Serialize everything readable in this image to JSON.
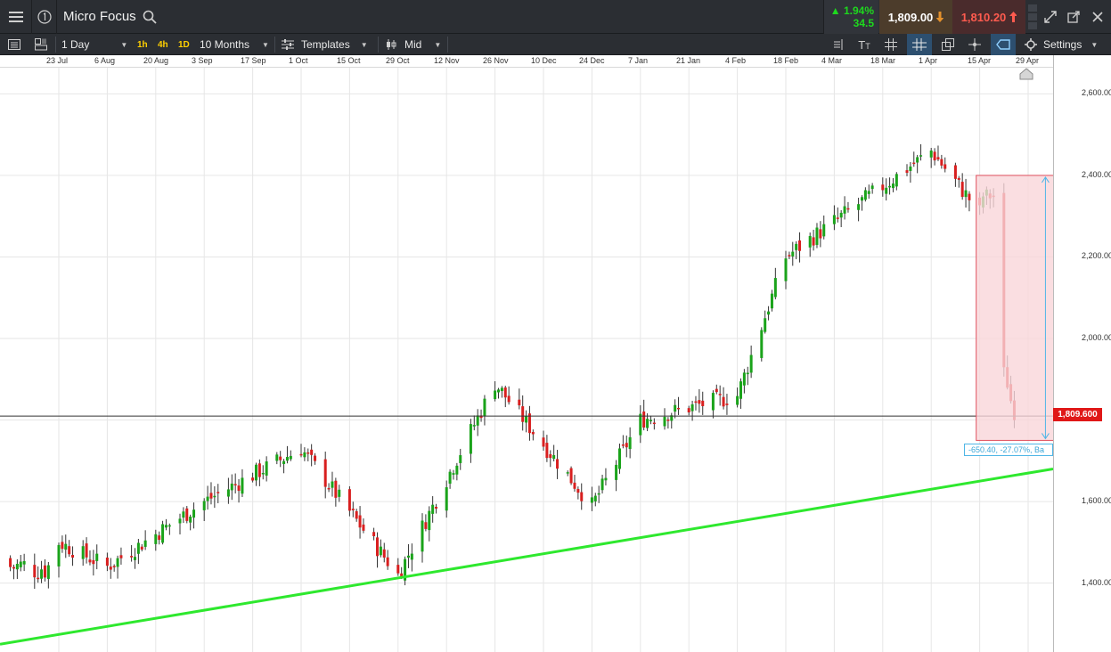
{
  "header": {
    "instrument_name": "Micro Focus",
    "change_percent": "1.94%",
    "change_abs": "34.5",
    "sell_price": "1,809.00",
    "buy_price": "1,810.20",
    "colors": {
      "up": "#1ed81e",
      "sell_bg": "#4c3c2b",
      "buy_bg": "#4a2b2c",
      "buy_text": "#ff5b4f"
    }
  },
  "toolbar": {
    "interval": "1 Day",
    "quick_intervals": [
      "1h",
      "4h",
      "1D"
    ],
    "range": "10 Months",
    "templates_label": "Templates",
    "price_mode": "Mid",
    "settings_label": "Settings"
  },
  "date_axis": [
    "23 Jul",
    "6 Aug",
    "20 Aug",
    "3 Sep",
    "17 Sep",
    "1 Oct",
    "15 Oct",
    "29 Oct",
    "12 Nov",
    "26 Nov",
    "10 Dec",
    "24 Dec",
    "7 Jan",
    "21 Jan",
    "4 Feb",
    "18 Feb",
    "4 Mar",
    "18 Mar",
    "1 Apr",
    "15 Apr",
    "29 Apr"
  ],
  "price_axis": [
    "2,600.000",
    "2,400.000",
    "2,200.000",
    "2,000.000",
    "1,600.000",
    "1,400.000"
  ],
  "last_price": "1,809.600",
  "measure_label": "-650.40, -27.07%, Ba",
  "chart_data": {
    "type": "candlestick",
    "instrument": "Micro Focus",
    "interval": "1 Day",
    "range": "10 Months",
    "x_ticks": [
      "23 Jul",
      "6 Aug",
      "20 Aug",
      "3 Sep",
      "17 Sep",
      "1 Oct",
      "15 Oct",
      "29 Oct",
      "12 Nov",
      "26 Nov",
      "10 Dec",
      "24 Dec",
      "7 Jan",
      "21 Jan",
      "4 Feb",
      "18 Feb",
      "4 Mar",
      "18 Mar",
      "1 Apr",
      "15 Apr",
      "29 Apr"
    ],
    "y_ticks": [
      1400,
      1600,
      2000,
      2200,
      2400,
      2600
    ],
    "ylim": [
      1250,
      2670
    ],
    "grid": true,
    "last_price": 1809.6,
    "colors": {
      "up": "#1aa31a",
      "down": "#d81f1f",
      "trendline": "#2ee82e",
      "measure_fill": "#f9d6da",
      "measure_stroke": "#e0505e",
      "measure_arrow": "#4fb6e6"
    },
    "key_points": [
      {
        "date": "23 Jul",
        "close": 1500
      },
      {
        "date": "6 Aug",
        "close": 1440
      },
      {
        "date": "3 Sep",
        "close": 1600
      },
      {
        "date": "1 Oct",
        "close": 1730
      },
      {
        "date": "29 Oct",
        "close": 1420
      },
      {
        "date": "26 Nov",
        "close": 1890
      },
      {
        "date": "24 Dec",
        "close": 1590
      },
      {
        "date": "7 Jan",
        "close": 1800
      },
      {
        "date": "4 Feb",
        "close": 1860
      },
      {
        "date": "18 Feb",
        "close": 2200
      },
      {
        "date": "1 Apr",
        "close": 2460
      },
      {
        "date": "15 Apr",
        "close": 2310
      },
      {
        "date": "29 Apr",
        "close": 1809.6
      }
    ],
    "trendline": {
      "start": {
        "date": "23 Jul",
        "price": 1250
      },
      "end": {
        "date": "29 Apr",
        "price": 1680
      }
    },
    "measurement": {
      "price_high": 2400,
      "price_low": 1750,
      "change": -650.4,
      "change_pct": -27.07
    }
  }
}
